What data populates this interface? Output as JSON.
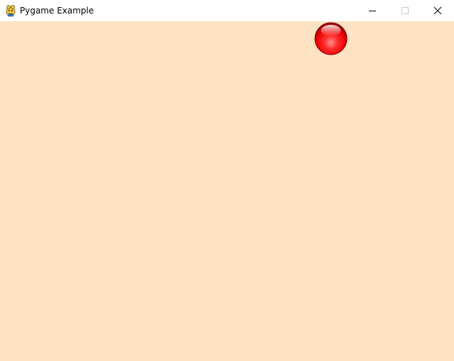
{
  "window": {
    "title": "Pygame Example",
    "app_icon": "pygame-snake-icon",
    "controls": {
      "minimize_icon": "minimize-icon",
      "maximize_icon": "maximize-icon",
      "close_icon": "close-icon"
    }
  },
  "game": {
    "background_color": "#fde3c4",
    "ball": {
      "color": "#ff1a1a",
      "icon": "red-ball"
    }
  }
}
